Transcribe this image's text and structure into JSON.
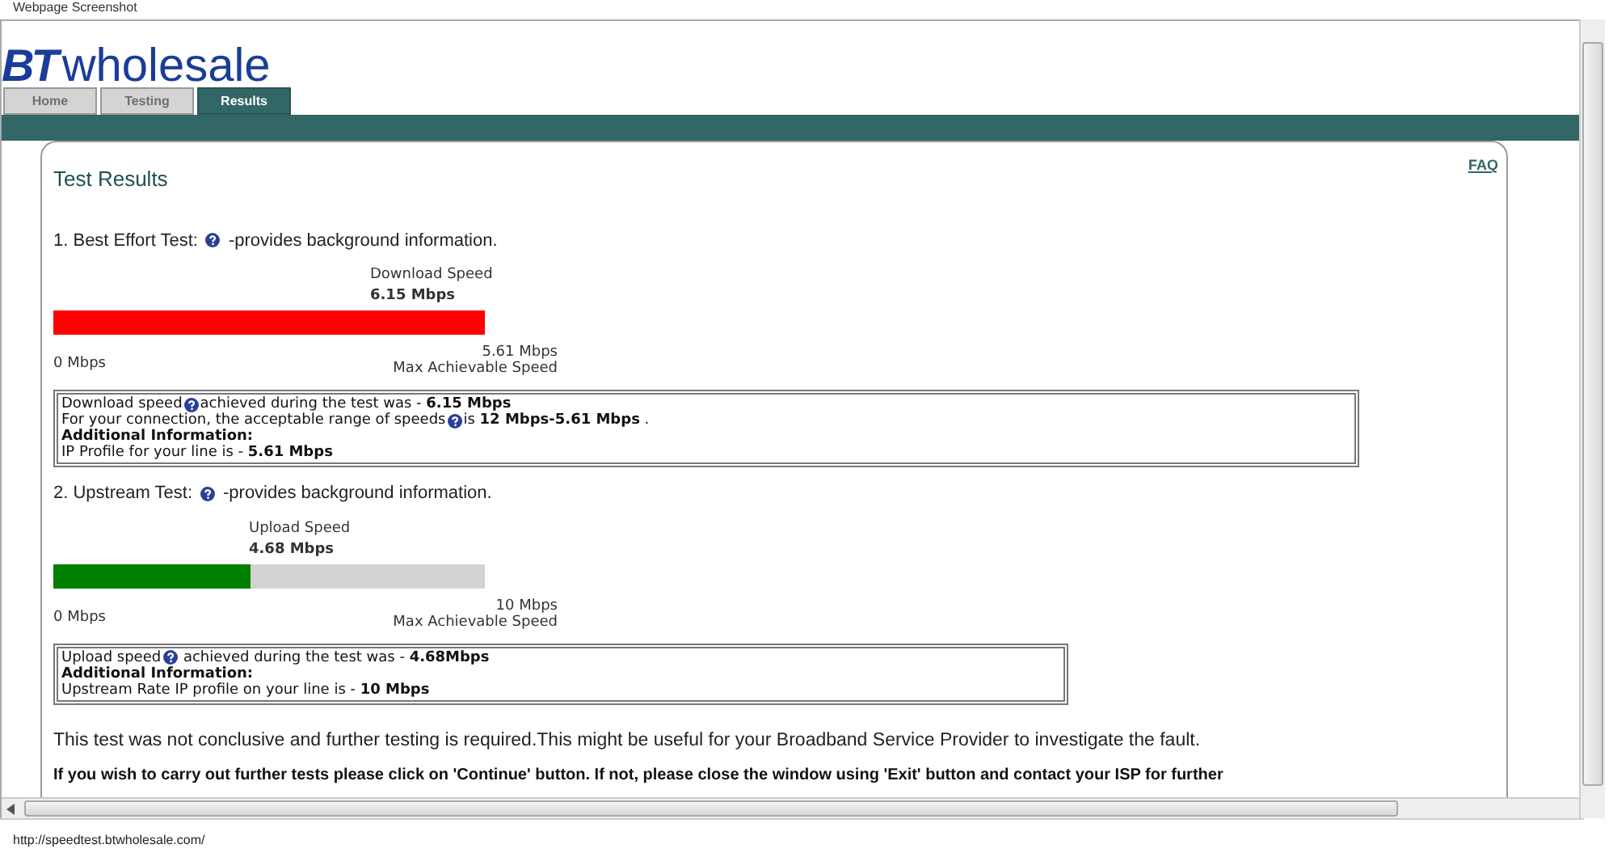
{
  "window": {
    "caption": "Webpage Screenshot",
    "status_url": "http://speedtest.btwholesale.com/"
  },
  "logo": {
    "brand": "BT",
    "name": "wholesale"
  },
  "tabs": [
    {
      "label": "Home",
      "selected": false
    },
    {
      "label": "Testing",
      "selected": false
    },
    {
      "label": "Results",
      "selected": true
    }
  ],
  "panel": {
    "title": "Test Results",
    "faq_link": "FAQ"
  },
  "tests": [
    {
      "heading": "1. Best Effort Test:",
      "note": "-provides background information.",
      "meter": {
        "label": "Download Speed",
        "value": "6.15 Mbps",
        "level": 1,
        "color": "#ff0000",
        "min": "0 Mbps",
        "max": "5.61 Mbps",
        "max_caption": "Max Achievable Speed"
      },
      "info_lines": [
        {
          "kind": "text",
          "lead": "Download speed",
          "help": true,
          "text": "achieved during the test was - **6.15 Mbps**"
        },
        {
          "kind": "text",
          "lead": "For your connection, the acceptable range of speeds",
          "help": true,
          "text": "is **12 Mbps-5.61 Mbps** ."
        },
        {
          "kind": "heading",
          "help": false,
          "text": "Additional Information:"
        },
        {
          "kind": "text",
          "help": false,
          "text": "IP Profile for your line is - **5.61 Mbps**"
        }
      ]
    },
    {
      "heading": "2. Upstream Test:",
      "note": "-provides background information.",
      "meter": {
        "label": "Upload Speed",
        "value": "4.68 Mbps",
        "level": 0.457,
        "color": "#008000",
        "min": "0 Mbps",
        "max": "10 Mbps",
        "max_caption": "Max Achievable Speed"
      },
      "info_lines": [
        {
          "kind": "text",
          "lead": "Upload speed",
          "help": true,
          "text": " achieved during the test was - **4.68Mbps**"
        },
        {
          "kind": "heading",
          "help": false,
          "text": "Additional Information:"
        },
        {
          "kind": "text",
          "help": false,
          "text": "Upstream Rate IP profile on your line is - **10 Mbps**"
        }
      ]
    }
  ],
  "conclusion": "This test was not conclusive and further testing is required.This might be useful for your Broadband Service Provider to investigate the fault.",
  "instruction": "If you wish to carry out further tests please click on 'Continue' button. If not, please close the window using 'Exit' button and contact your ISP for further"
}
